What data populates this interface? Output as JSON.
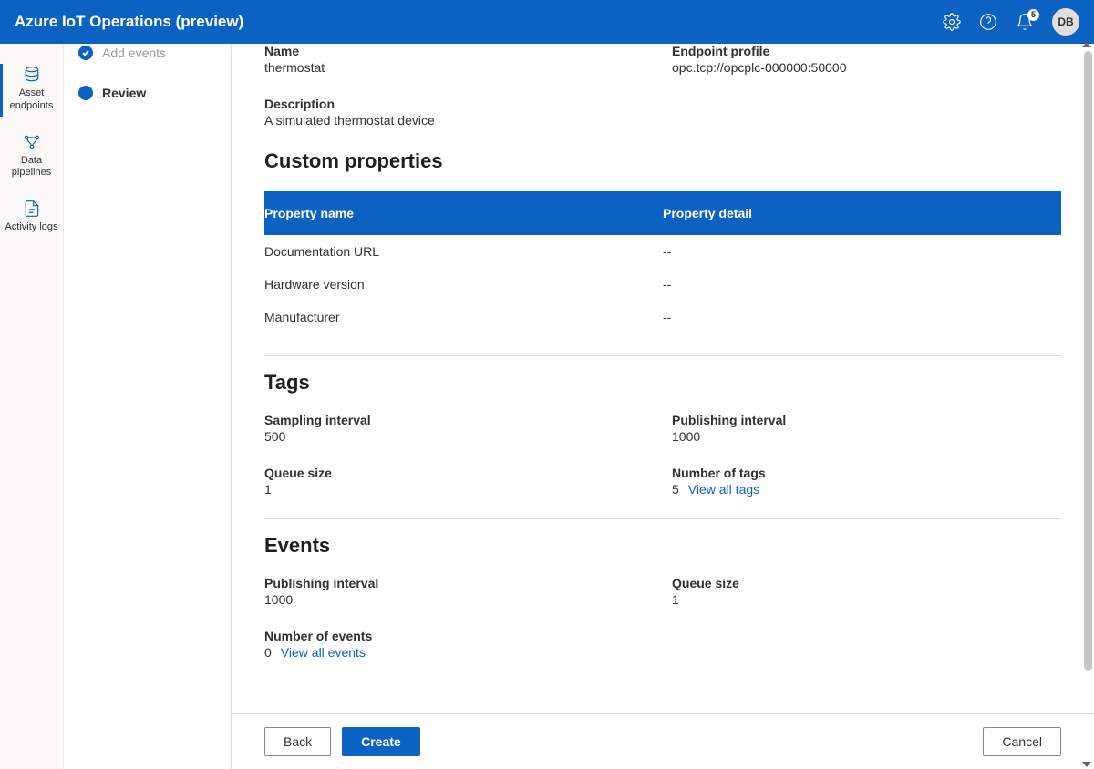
{
  "header": {
    "title": "Azure IoT Operations (preview)",
    "notification_count": "5",
    "avatar_initials": "DB"
  },
  "left_rail": {
    "items": [
      {
        "label": "Asset endpoints"
      },
      {
        "label": "Data pipelines"
      },
      {
        "label": "Activity logs"
      }
    ]
  },
  "steps": {
    "add_events": "Add events",
    "review": "Review"
  },
  "basic": {
    "name_label": "Name",
    "name_value": "thermostat",
    "endpoint_label": "Endpoint profile",
    "endpoint_value": "opc.tcp://opcplc-000000:50000",
    "description_label": "Description",
    "description_value": "A simulated thermostat device"
  },
  "custom_properties": {
    "title": "Custom properties",
    "header_name": "Property name",
    "header_detail": "Property detail",
    "rows": [
      {
        "name": "Documentation URL",
        "detail": "--"
      },
      {
        "name": "Hardware version",
        "detail": "--"
      },
      {
        "name": "Manufacturer",
        "detail": "--"
      }
    ]
  },
  "tags": {
    "title": "Tags",
    "sampling_label": "Sampling interval",
    "sampling_value": "500",
    "publishing_label": "Publishing interval",
    "publishing_value": "1000",
    "queue_label": "Queue size",
    "queue_value": "1",
    "number_label": "Number of tags",
    "number_value": "5",
    "view_all": "View all tags"
  },
  "events": {
    "title": "Events",
    "publishing_label": "Publishing interval",
    "publishing_value": "1000",
    "queue_label": "Queue size",
    "queue_value": "1",
    "number_label": "Number of events",
    "number_value": "0",
    "view_all": "View all events"
  },
  "footer": {
    "back": "Back",
    "create": "Create",
    "cancel": "Cancel"
  }
}
